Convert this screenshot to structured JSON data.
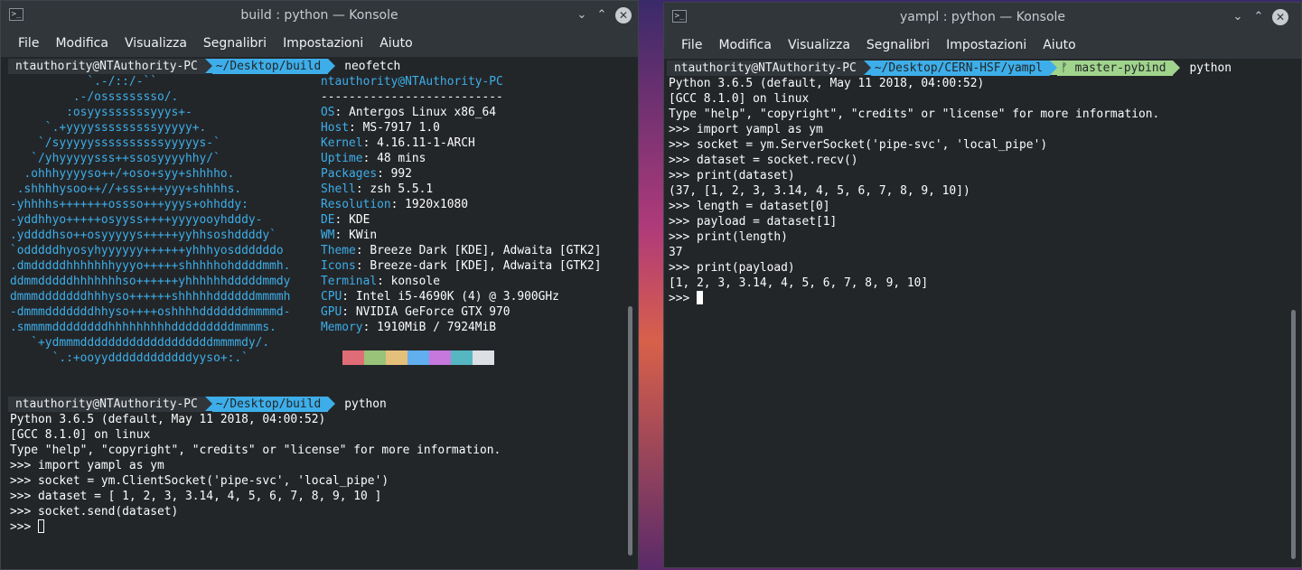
{
  "left_window": {
    "title": "build : python — Konsole",
    "menu": [
      "File",
      "Modifica",
      "Visualizza",
      "Segnalibri",
      "Impostazioni",
      "Aiuto"
    ],
    "prompt1": {
      "user": "ntauthority@NTAuthority-PC",
      "dir": "~/Desktop/build",
      "command": "neofetch"
    },
    "ascii_art": [
      "           `.-/::/-``",
      "         .-/osssssssso/.",
      "        :osyysssssssyyys+-",
      "     `.+yyyysssssssssyyyyy+.",
      "    `/syyyyyssssssssssyyyyys-`",
      "   `/yhyyyyysss++ssosyyyyhhy/`",
      "  .ohhhyyyyso++/+oso+syy+shhhho.",
      " .shhhhysoo++//+sss+++yyy+shhhhs.",
      "-yhhhhs+++++++ossso+++yyys+ohhddy:",
      "-yddhhyo+++++osyyss++++yyyyooyhdddy-",
      ".yddddhso++osyyyyys+++++yyhhsoshddddy`",
      "`odddddhyosyhyyyyyy++++++yhhhyosddddddo",
      ".dmdddddhhhhhhhyyyo+++++shhhhhohddddmmh.",
      "ddmmdddddhhhhhhhso++++++yhhhhhhdddddmmdy",
      "dmmmdddddddhhhyso++++++shhhhhddddddmmmmh",
      "-dmmmdddddddhhyso++++oshhhhdddddddmmmmd-",
      ".smmmmddddddddhhhhhhhhhdddddddddmmmms.",
      "   `+ydmmmdddddddddddddddddddmmmmdy/.",
      "      `.:+ooyyddddddddddddyyso+:.`"
    ],
    "sysinfo_header": "ntauthority@NTAuthority-PC",
    "sysinfo_separator": "--------------------------",
    "sysinfo": [
      {
        "key": "OS",
        "value": "Antergos Linux x86_64"
      },
      {
        "key": "Host",
        "value": "MS-7917 1.0"
      },
      {
        "key": "Kernel",
        "value": "4.16.11-1-ARCH"
      },
      {
        "key": "Uptime",
        "value": "48 mins"
      },
      {
        "key": "Packages",
        "value": "992"
      },
      {
        "key": "Shell",
        "value": "zsh 5.5.1"
      },
      {
        "key": "Resolution",
        "value": "1920x1080"
      },
      {
        "key": "DE",
        "value": "KDE"
      },
      {
        "key": "WM",
        "value": "KWin"
      },
      {
        "key": "Theme",
        "value": "Breeze Dark [KDE], Adwaita [GTK2]"
      },
      {
        "key": "Icons",
        "value": "Breeze-dark [KDE], Adwaita [GTK2]"
      },
      {
        "key": "Terminal",
        "value": "konsole"
      },
      {
        "key": "CPU",
        "value": "Intel i5-4690K (4) @ 3.900GHz"
      },
      {
        "key": "GPU",
        "value": "NVIDIA GeForce GTX 970"
      },
      {
        "key": "Memory",
        "value": "1910MiB / 7924MiB"
      }
    ],
    "swatch_colors": [
      "#e06c75",
      "#98c379",
      "#e5c07b",
      "#61afef",
      "#c678dd",
      "#56b6c2",
      "#dcdfe4"
    ],
    "prompt2": {
      "user": "ntauthority@NTAuthority-PC",
      "dir": "~/Desktop/build",
      "command": "python"
    },
    "python_lines": [
      "Python 3.6.5 (default, May 11 2018, 04:00:52)",
      "[GCC 8.1.0] on linux",
      "Type \"help\", \"copyright\", \"credits\" or \"license\" for more information.",
      ">>> import yampl as ym",
      ">>> socket = ym.ClientSocket('pipe-svc', 'local_pipe')",
      ">>> dataset = [ 1, 2, 3, 3.14, 4, 5, 6, 7, 8, 9, 10 ]",
      ">>> socket.send(dataset)"
    ],
    "last_prompt": ">>> "
  },
  "right_window": {
    "title": "yampl : python — Konsole",
    "menu": [
      "File",
      "Modifica",
      "Visualizza",
      "Segnalibri",
      "Impostazioni",
      "Aiuto"
    ],
    "prompt": {
      "user": "ntauthority@NTAuthority-PC",
      "dir": "~/Desktop/CERN-HSF/yampl",
      "git_icon": "ᚠ",
      "git": "master-pybind",
      "command": "python"
    },
    "python_lines": [
      "Python 3.6.5 (default, May 11 2018, 04:00:52)",
      "[GCC 8.1.0] on linux",
      "Type \"help\", \"copyright\", \"credits\" or \"license\" for more information.",
      ">>> import yampl as ym",
      ">>> socket = ym.ServerSocket('pipe-svc', 'local_pipe')",
      ">>> dataset = socket.recv()",
      ">>> print(dataset)",
      "(37, [1, 2, 3, 3.14, 4, 5, 6, 7, 8, 9, 10])",
      ">>> length = dataset[0]",
      ">>> payload = dataset[1]",
      ">>> print(length)",
      "37",
      ">>> print(payload)",
      "[1, 2, 3, 3.14, 4, 5, 6, 7, 8, 9, 10]"
    ],
    "last_prompt": ">>> "
  },
  "colors": {
    "terminal_bg": "#232629",
    "chrome_bg": "#31363b",
    "dir_segment": "#3daee9",
    "git_segment": "#a0d48c",
    "text": "#fcfcfc"
  }
}
